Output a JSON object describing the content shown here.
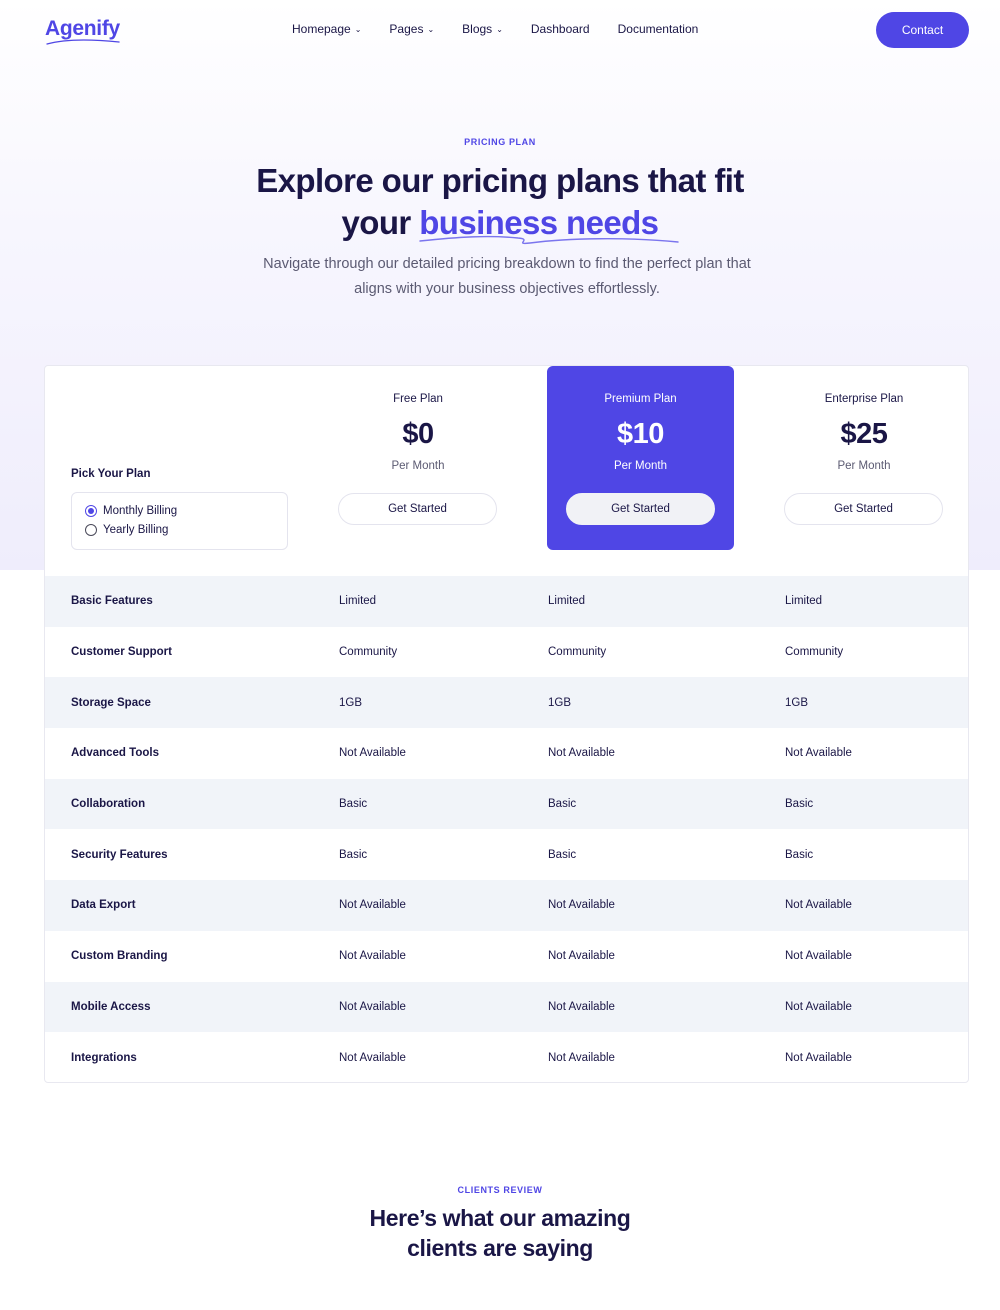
{
  "nav": {
    "logo": "Agenify",
    "links": [
      {
        "label": "Homepage",
        "has_dropdown": true
      },
      {
        "label": "Pages",
        "has_dropdown": true
      },
      {
        "label": "Blogs",
        "has_dropdown": true
      },
      {
        "label": "Dashboard",
        "has_dropdown": false
      },
      {
        "label": "Documentation",
        "has_dropdown": false
      }
    ],
    "contact_label": "Contact"
  },
  "hero": {
    "eyebrow": "PRICING PLAN",
    "title_line1": "Explore our pricing plans that fit",
    "title_line2_prefix": "your ",
    "title_line2_accent": "business needs",
    "subtitle": "Navigate through our detailed pricing breakdown to find the perfect plan that aligns with your business objectives effortlessly."
  },
  "pricing": {
    "pick_label": "Pick Your Plan",
    "billing_options": [
      {
        "label": "Monthly Billing",
        "selected": true
      },
      {
        "label": "Yearly Billing",
        "selected": false
      }
    ],
    "plans": [
      {
        "name": "Free Plan",
        "price": "$0",
        "period": "Per Month",
        "cta": "Get Started"
      },
      {
        "name": "Premium Plan",
        "price": "$10",
        "period": "Per Month",
        "cta": "Get Started",
        "highlighted": true
      },
      {
        "name": "Enterprise Plan",
        "price": "$25",
        "period": "Per Month",
        "cta": "Get Started"
      }
    ],
    "features": [
      {
        "name": "Basic Features",
        "values": [
          "Limited",
          "Limited",
          "Limited"
        ]
      },
      {
        "name": "Customer Support",
        "values": [
          "Community",
          "Community",
          "Community"
        ]
      },
      {
        "name": "Storage Space",
        "values": [
          "1GB",
          "1GB",
          "1GB"
        ]
      },
      {
        "name": "Advanced Tools",
        "values": [
          "Not Available",
          "Not Available",
          "Not Available"
        ]
      },
      {
        "name": "Collaboration",
        "values": [
          "Basic",
          "Basic",
          "Basic"
        ]
      },
      {
        "name": "Security Features",
        "values": [
          "Basic",
          "Basic",
          "Basic"
        ]
      },
      {
        "name": "Data Export",
        "values": [
          "Not Available",
          "Not Available",
          "Not Available"
        ]
      },
      {
        "name": "Custom Branding",
        "values": [
          "Not Available",
          "Not Available",
          "Not Available"
        ]
      },
      {
        "name": "Mobile Access",
        "values": [
          "Not Available",
          "Not Available",
          "Not Available"
        ]
      },
      {
        "name": "Integrations",
        "values": [
          "Not Available",
          "Not Available",
          "Not Available"
        ]
      }
    ]
  },
  "clients": {
    "eyebrow": "CLIENTS REVIEW",
    "title_line1": "Here’s what our amazing",
    "title_line2": "clients are saying"
  },
  "colors": {
    "accent": "#4f46e5",
    "heading": "#1a1646",
    "row_alt": "#f1f4f9"
  }
}
